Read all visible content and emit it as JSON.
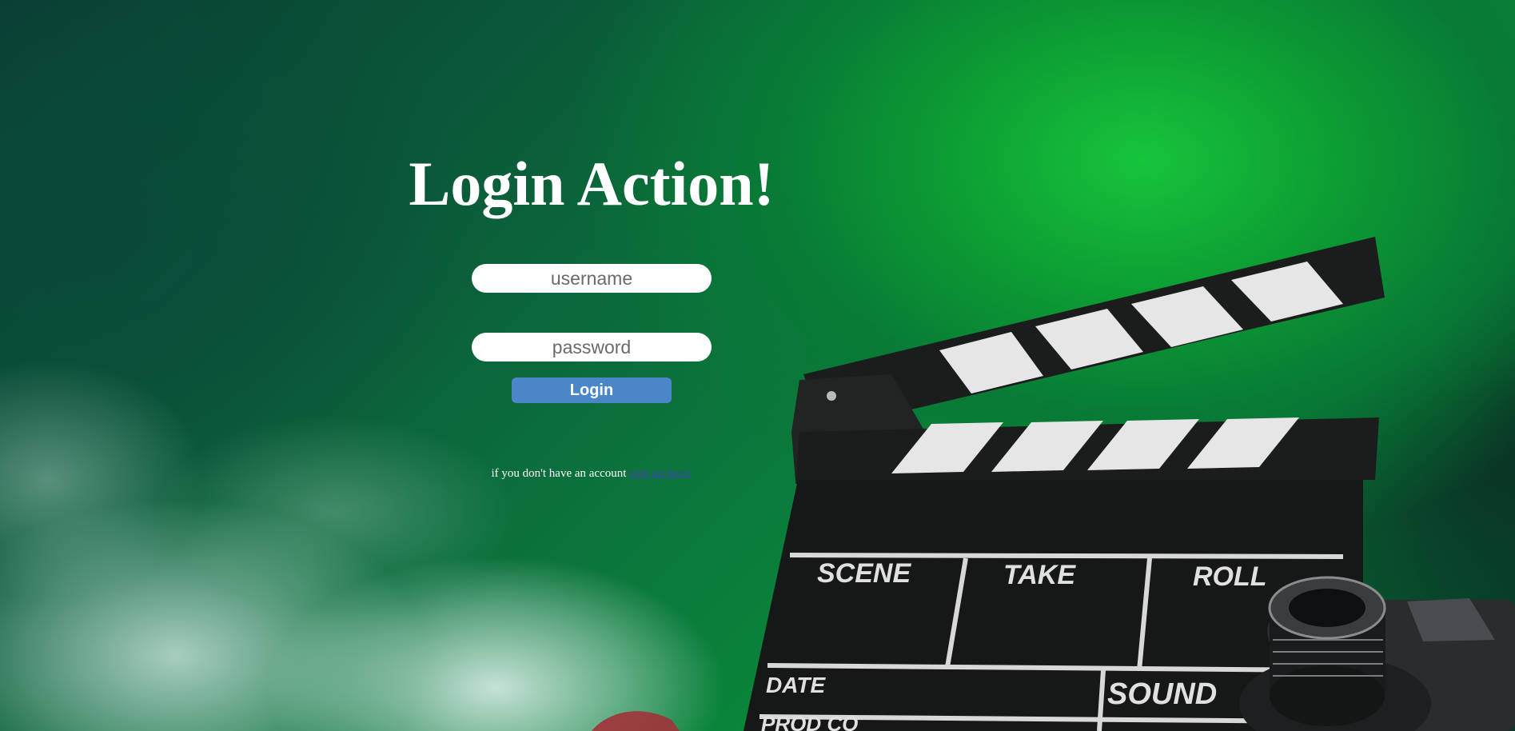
{
  "login": {
    "title": "Login Action!",
    "username_placeholder": "username",
    "password_placeholder": "password",
    "button_label": "Login",
    "signup_prompt": "if you don't have an account",
    "signup_link": "sign up here!"
  },
  "background": {
    "clapper": {
      "scene_label": "SCENE",
      "take_label": "TAKE",
      "roll_label": "ROLL",
      "date_label": "DATE",
      "sound_label": "SOUND",
      "prod_label": "PROD CO"
    }
  }
}
